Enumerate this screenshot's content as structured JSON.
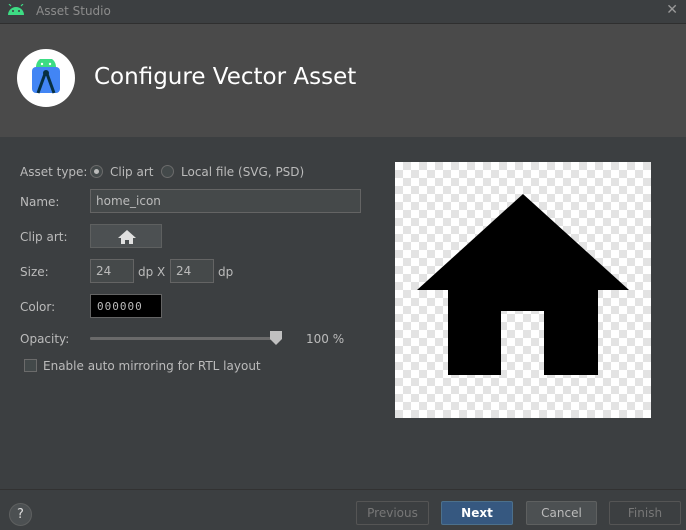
{
  "window": {
    "title": "Asset Studio",
    "close_icon": "close-icon",
    "app_icon": "android-icon"
  },
  "header": {
    "title": "Configure Vector Asset",
    "logo_icon": "android-studio-logo"
  },
  "form": {
    "asset_type_label": "Asset type:",
    "asset_type_options": [
      {
        "label": "Clip art",
        "selected": true
      },
      {
        "label": "Local file (SVG, PSD)",
        "selected": false
      }
    ],
    "name_label": "Name:",
    "name_value": "home_icon",
    "clip_art_label": "Clip art:",
    "clip_art_icon": "home-icon",
    "size_label": "Size:",
    "size_width": "24",
    "size_height": "24",
    "size_unit": "dp",
    "size_separator": "X",
    "color_label": "Color:",
    "color_value": "000000",
    "opacity_label": "Opacity:",
    "opacity_value": "100 %",
    "opacity_level": 1.0,
    "mirroring_label": "Enable auto mirroring for RTL layout",
    "mirroring_checked": false
  },
  "preview": {
    "icon": "home-icon",
    "icon_color": "#000000"
  },
  "footer": {
    "help_label": "?",
    "previous_label": "Previous",
    "next_label": "Next",
    "cancel_label": "Cancel",
    "finish_label": "Finish"
  },
  "colors": {
    "background": "#3c3f41",
    "header_background": "#4a4a4a",
    "primary_button": "#365880",
    "android_green": "#3ddc84"
  }
}
